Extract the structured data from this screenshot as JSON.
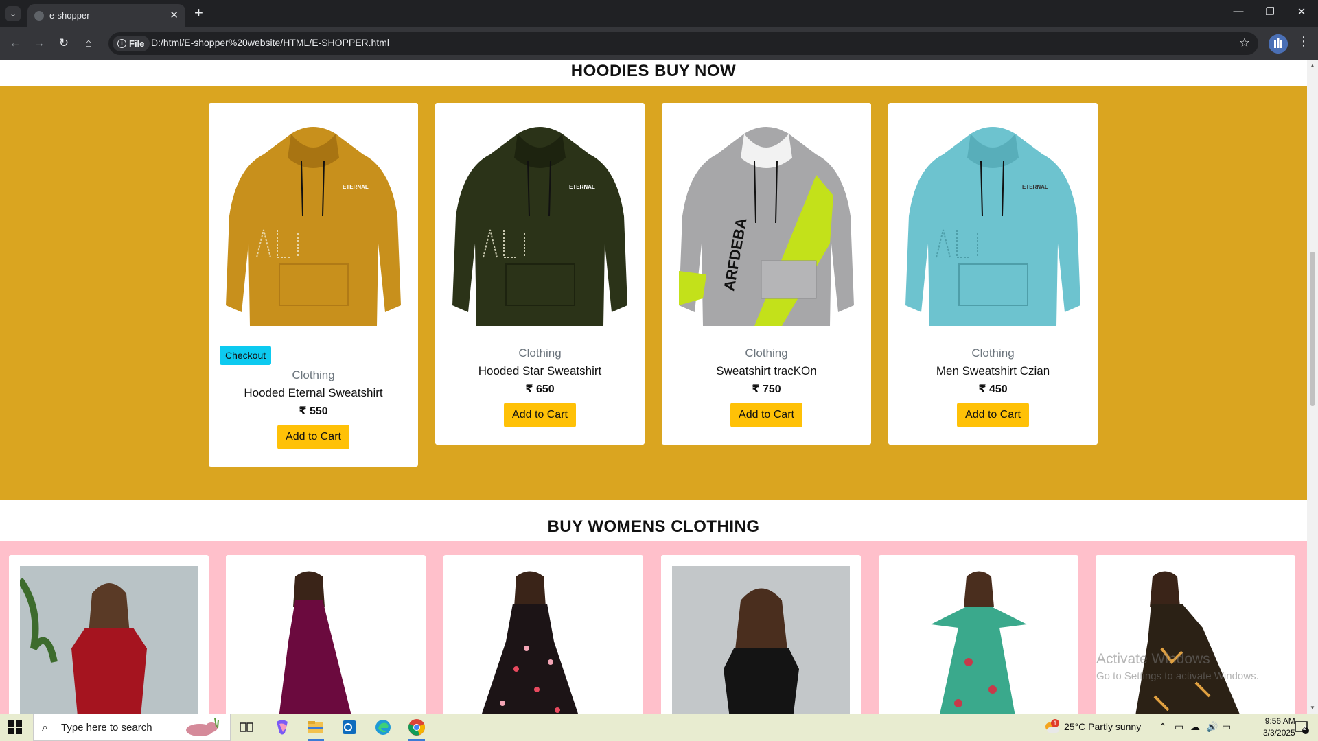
{
  "browser": {
    "tab_title": "e-shopper",
    "url_chip": "File",
    "url": "D:/html/E-shopper%20website/HTML/E-SHOPPER.html"
  },
  "hoodies": {
    "title": "HOODIES BUY NOW",
    "checkout_label": "Checkout",
    "add_label": "Add to Cart",
    "items": [
      {
        "category": "Clothing",
        "name": "Hooded Eternal Sweatshirt",
        "price": "₹ 550",
        "color": "#c8901c",
        "print": "ETERNAL"
      },
      {
        "category": "Clothing",
        "name": "Hooded Star Sweatshirt",
        "price": "₹ 650",
        "color": "#2b3318",
        "print": "ETERNAL"
      },
      {
        "category": "Clothing",
        "name": "Sweatshirt tracKOn",
        "price": "₹ 750",
        "color": "#a7a7a9",
        "print": "ARFDEBA"
      },
      {
        "category": "Clothing",
        "name": "Men Sweatshirt Czian",
        "price": "₹ 450",
        "color": "#6dc3cf",
        "print": "ETERNAL"
      }
    ]
  },
  "womens": {
    "title": "BUY WOMENS CLOTHING",
    "items": [
      {
        "dress_color": "#a5141f",
        "bg": "#b9c3c6"
      },
      {
        "dress_color": "#6b0a3e",
        "bg": "#ffffff"
      },
      {
        "dress_color": "#1c1416",
        "bg": "#ffffff"
      },
      {
        "dress_color": "#141414",
        "bg": "#c3c7c9"
      },
      {
        "dress_color": "#3aa98c",
        "bg": "#ffffff"
      },
      {
        "dress_color": "#2b2115",
        "bg": "#ffffff"
      }
    ]
  },
  "watermark": {
    "line1": "Activate Windows",
    "line2": "Go to Settings to activate Windows."
  },
  "taskbar": {
    "search_placeholder": "Type here to search",
    "weather": "25°C  Partly sunny",
    "weather_badge": "1",
    "time": "9:56 AM",
    "date": "3/3/2025",
    "notification_count": "2"
  }
}
